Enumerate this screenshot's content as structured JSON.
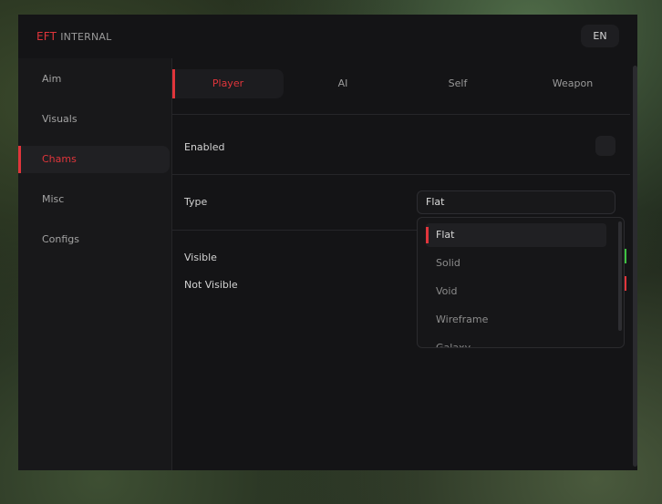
{
  "header": {
    "logo_accent": "EFT",
    "logo_rest": "INTERNAL",
    "language": "EN"
  },
  "sidebar": {
    "items": [
      {
        "label": "Aim"
      },
      {
        "label": "Visuals"
      },
      {
        "label": "Chams"
      },
      {
        "label": "Misc"
      },
      {
        "label": "Configs"
      }
    ],
    "active": "Chams"
  },
  "tabs": {
    "items": [
      {
        "label": "Player"
      },
      {
        "label": "AI"
      },
      {
        "label": "Self"
      },
      {
        "label": "Weapon"
      }
    ],
    "active": "Player"
  },
  "settings": {
    "enabled_label": "Enabled",
    "enabled_checked": false,
    "type_label": "Type",
    "type_value": "Flat",
    "type_options": [
      "Flat",
      "Solid",
      "Void",
      "Wireframe",
      "Galaxy"
    ],
    "visible_label": "Visible",
    "not_visible_label": "Not Visible"
  },
  "colors": {
    "accent": "#e0353b",
    "visible_color": "#3ec142",
    "not_visible_color": "#e0353b"
  }
}
